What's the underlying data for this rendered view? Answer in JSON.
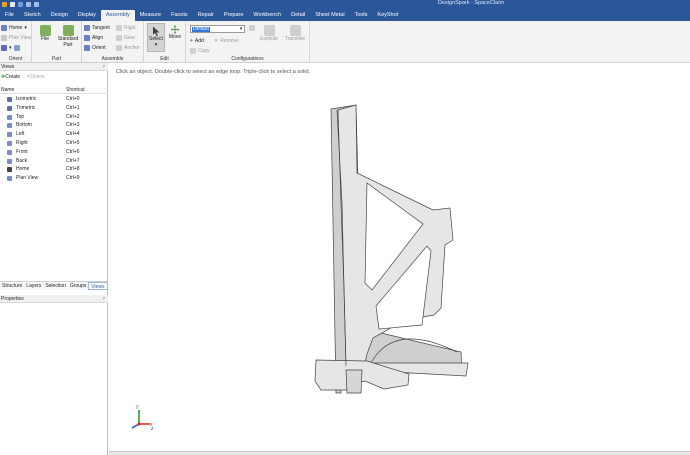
{
  "titlebar": {
    "title": "DesignSpark - SpaceClaim",
    "accent": "#2b579a"
  },
  "menu": {
    "tabs": [
      "File",
      "Sketch",
      "Design",
      "Display",
      "Assembly",
      "Measure",
      "Facets",
      "Repair",
      "Prepare",
      "Workbench",
      "Detail",
      "Sheet Metal",
      "Tools",
      "KeyShot"
    ],
    "active": "Assembly"
  },
  "ribbon": {
    "orient": {
      "home": "Home",
      "plan_view": "Plan View",
      "label": "Orient"
    },
    "part": {
      "file": "File",
      "standard_part": "Standard Part",
      "label": "Part"
    },
    "assemble": {
      "tangent": "Tangent",
      "align": "Align",
      "orient": "Orient",
      "rigid": "Rigid",
      "gear": "Gear",
      "anchor": "Anchor",
      "label": "Assemble"
    },
    "edit": {
      "select": "Select",
      "move": "Move",
      "label": "Edit"
    },
    "configurations": {
      "combo_value": "Default",
      "add": "Add",
      "remove": "Remove",
      "copy": "Copy",
      "explode": "Explode",
      "traceline": "Traceline",
      "label": "Configurations"
    }
  },
  "views_panel": {
    "title": "Views",
    "create": "Create",
    "delete": "Delete",
    "col_name": "Name",
    "col_shortcut": "Shortcut",
    "items": [
      {
        "name": "Isometric",
        "shortcut": "Ctrl+0"
      },
      {
        "name": "Trimetric",
        "shortcut": "Ctrl+1"
      },
      {
        "name": "Top",
        "shortcut": "Ctrl+2"
      },
      {
        "name": "Bottom",
        "shortcut": "Ctrl+3"
      },
      {
        "name": "Left",
        "shortcut": "Ctrl+4"
      },
      {
        "name": "Right",
        "shortcut": "Ctrl+5"
      },
      {
        "name": "Front",
        "shortcut": "Ctrl+6"
      },
      {
        "name": "Back",
        "shortcut": "Ctrl+7"
      },
      {
        "name": "Home",
        "shortcut": "Ctrl+8"
      },
      {
        "name": "Plan View",
        "shortcut": "Ctrl+9"
      }
    ]
  },
  "panel_tabs": {
    "items": [
      "Structure",
      "Layers",
      "Selection",
      "Groups",
      "Views"
    ],
    "active": "Views"
  },
  "properties_panel": {
    "title": "Properties"
  },
  "canvas": {
    "hint": "Click an object. Double-click to select an edge loop. Triple-click to select a solid."
  },
  "triad": {
    "x": "x",
    "y": "y",
    "z": "z"
  }
}
